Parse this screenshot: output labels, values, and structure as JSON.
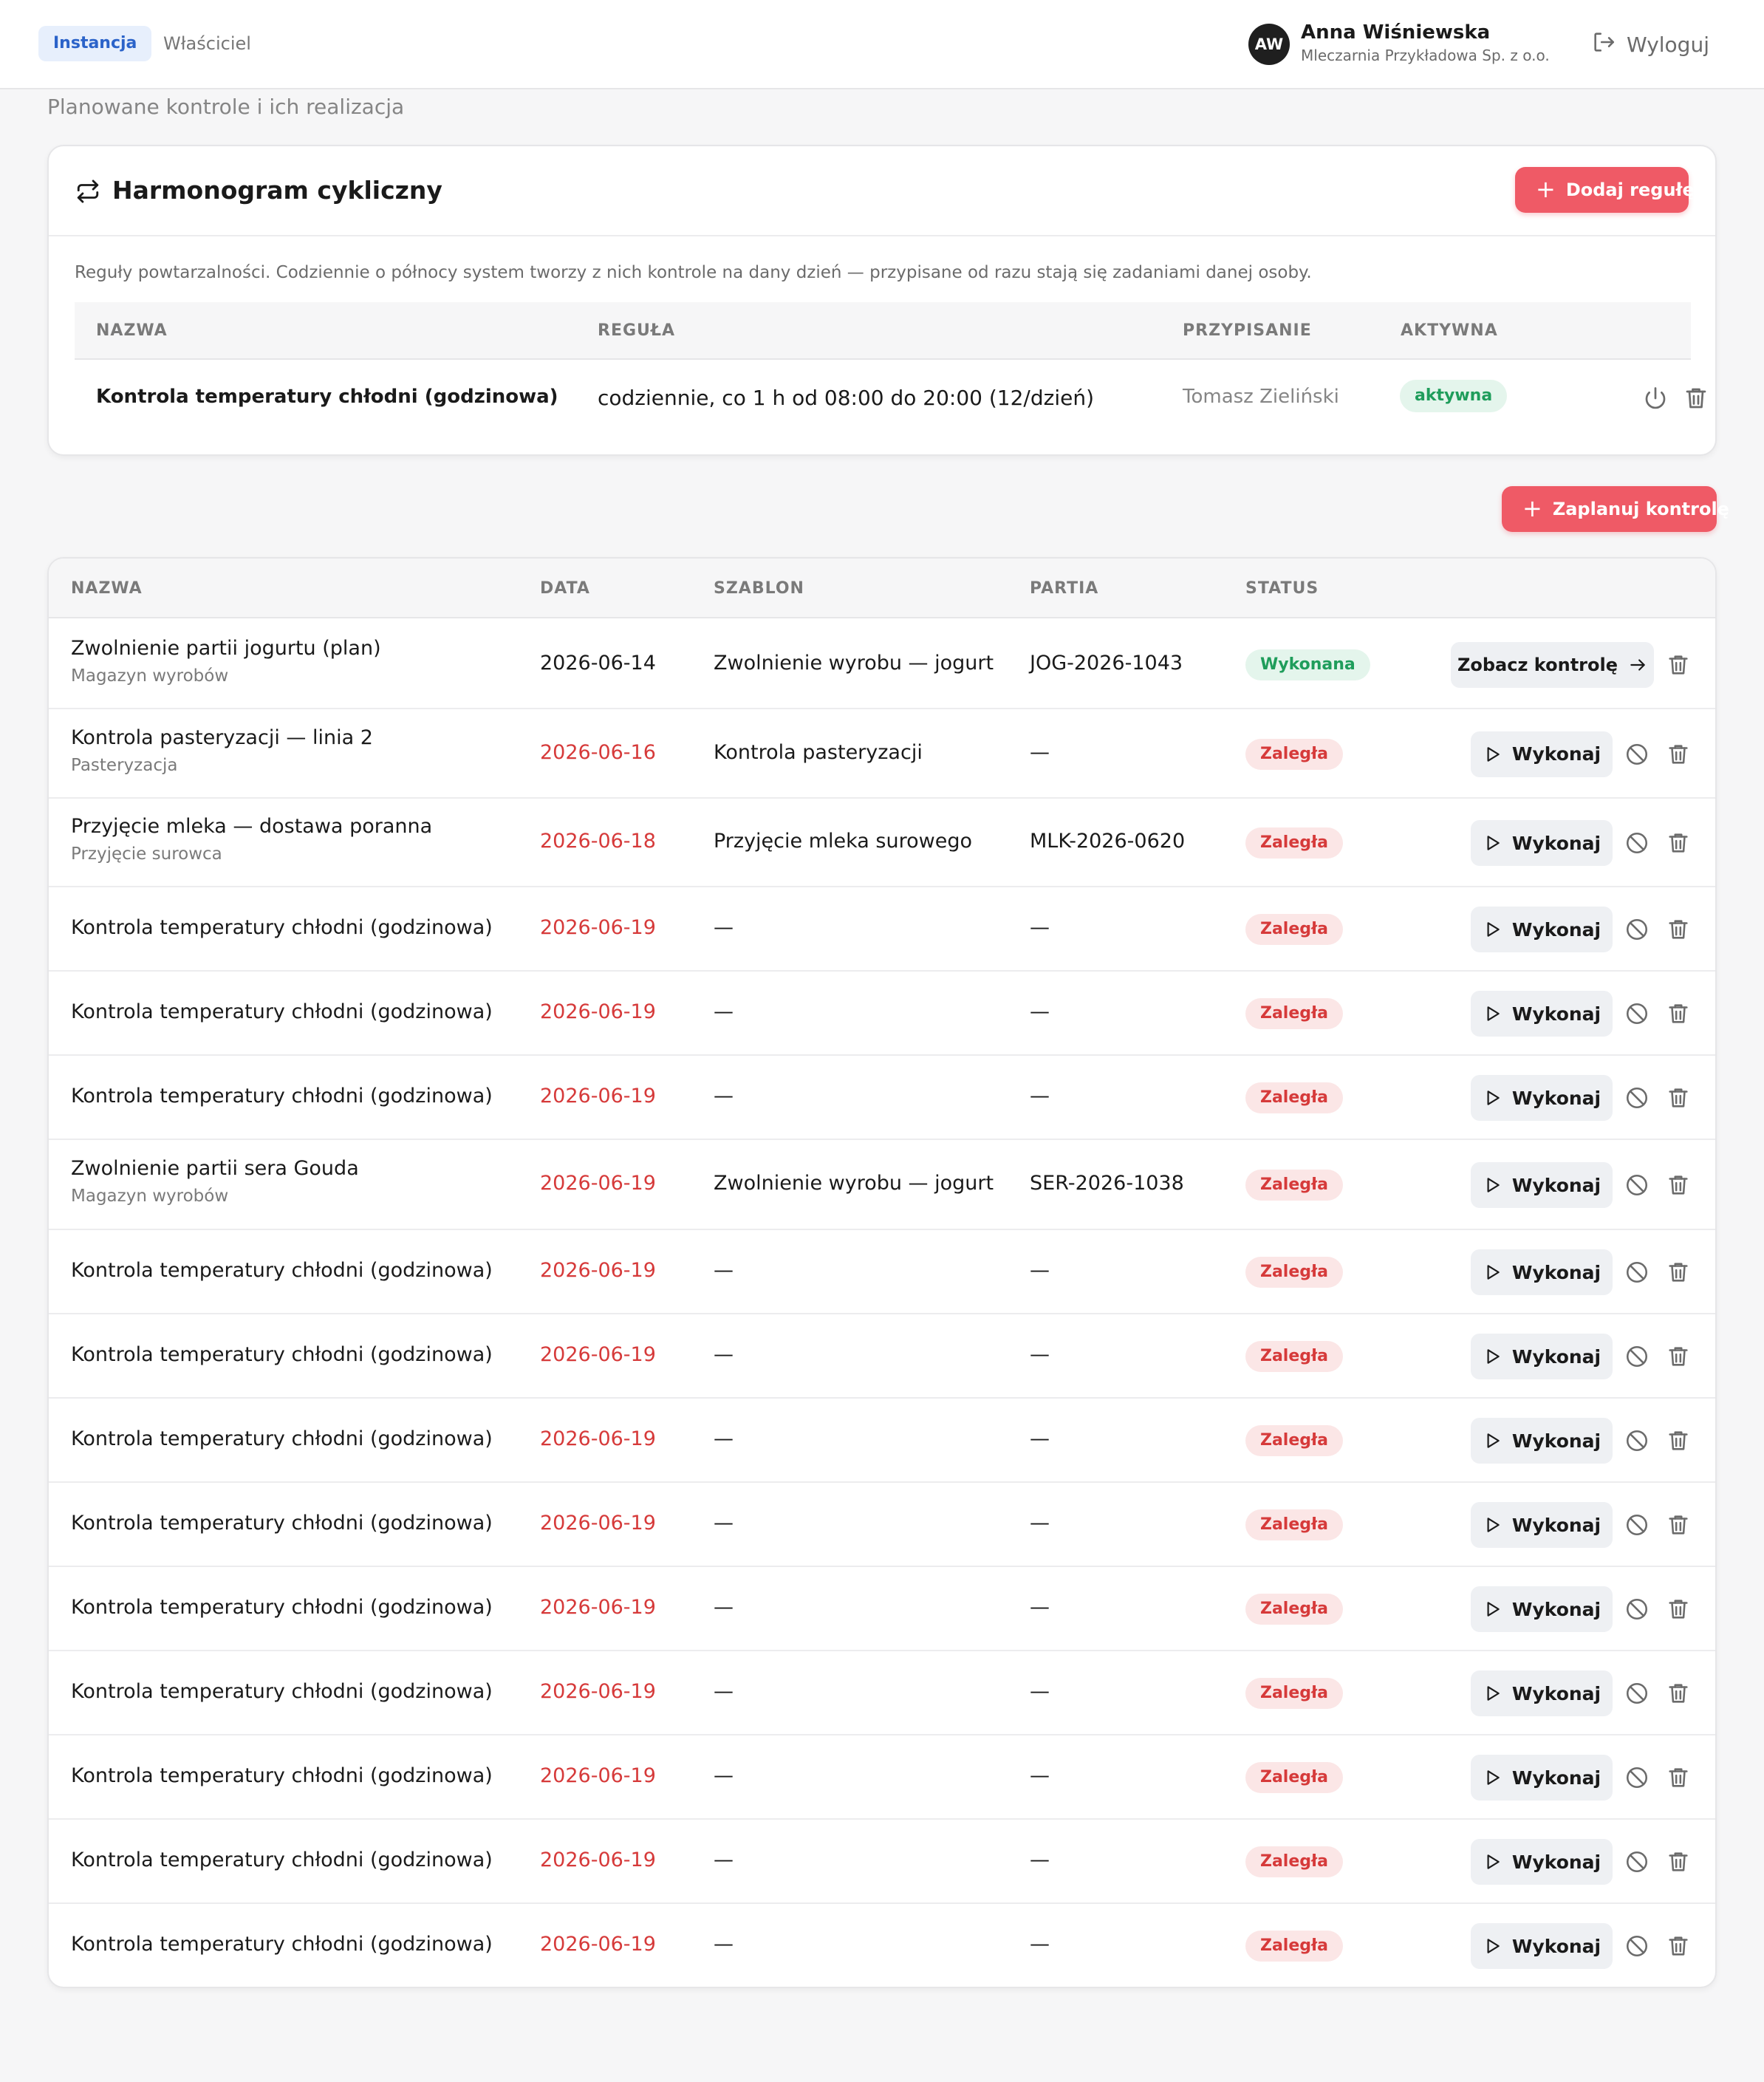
{
  "topbar": {
    "tabs": [
      {
        "label": "Instancja",
        "active": true
      },
      {
        "label": "Właściciel",
        "active": false
      }
    ],
    "user": {
      "initials": "AW",
      "name": "Anna Wiśniewska",
      "org": "Mleczarnia Przykładowa Sp. z o.o."
    },
    "logout_label": "Wyloguj"
  },
  "page": {
    "subtitle": "Planowane kontrole i ich realizacja"
  },
  "rules": {
    "title": "Harmonogram cykliczny",
    "add_button": "Dodaj regułę",
    "description": "Reguły powtarzalności. Codziennie o północy system tworzy z nich kontrole na dany dzień — przypisane od razu stają się zadaniami danej osoby.",
    "columns": [
      "NAZWA",
      "REGUŁA",
      "PRZYPISANIE",
      "AKTYWNA"
    ],
    "rows": [
      {
        "name": "Kontrola temperatury chłodni (godzinowa)",
        "rule": "codziennie, co 1 h od 08:00 do 20:00 (12/dzień)",
        "assignee": "Tomasz Zieliński",
        "active": "aktywna"
      }
    ]
  },
  "controls": {
    "plan_button": "Zaplanuj kontrolę",
    "columns": [
      "NAZWA",
      "DATA",
      "SZABLON",
      "PARTIA",
      "STATUS"
    ],
    "run_label": "Wykonaj",
    "view_label": "Zobacz kontrolę",
    "colors": {
      "overdue": "#d63a3a",
      "done": "#1f9d5b",
      "primary": "#ef5a66"
    },
    "rows": [
      {
        "name": "Zwolnienie partii jogurtu (plan)",
        "sub": "Magazyn wyrobów",
        "date": "2026-06-14",
        "template": "Zwolnienie wyrobu — jogurt",
        "batch": "JOG-2026-1043",
        "status": "Wykonana",
        "state": "done"
      },
      {
        "name": "Kontrola pasteryzacji — linia 2",
        "sub": "Pasteryzacja",
        "date": "2026-06-16",
        "template": "Kontrola pasteryzacji",
        "batch": "—",
        "status": "Zaległa",
        "state": "overdue"
      },
      {
        "name": "Przyjęcie mleka — dostawa poranna",
        "sub": "Przyjęcie surowca",
        "date": "2026-06-18",
        "template": "Przyjęcie mleka surowego",
        "batch": "MLK-2026-0620",
        "status": "Zaległa",
        "state": "overdue"
      },
      {
        "name": "Kontrola temperatury chłodni (godzinowa)",
        "sub": "",
        "date": "2026-06-19",
        "template": "—",
        "batch": "—",
        "status": "Zaległa",
        "state": "overdue"
      },
      {
        "name": "Kontrola temperatury chłodni (godzinowa)",
        "sub": "",
        "date": "2026-06-19",
        "template": "—",
        "batch": "—",
        "status": "Zaległa",
        "state": "overdue"
      },
      {
        "name": "Kontrola temperatury chłodni (godzinowa)",
        "sub": "",
        "date": "2026-06-19",
        "template": "—",
        "batch": "—",
        "status": "Zaległa",
        "state": "overdue"
      },
      {
        "name": "Zwolnienie partii sera Gouda",
        "sub": "Magazyn wyrobów",
        "date": "2026-06-19",
        "template": "Zwolnienie wyrobu — jogurt",
        "batch": "SER-2026-1038",
        "status": "Zaległa",
        "state": "overdue"
      },
      {
        "name": "Kontrola temperatury chłodni (godzinowa)",
        "sub": "",
        "date": "2026-06-19",
        "template": "—",
        "batch": "—",
        "status": "Zaległa",
        "state": "overdue"
      },
      {
        "name": "Kontrola temperatury chłodni (godzinowa)",
        "sub": "",
        "date": "2026-06-19",
        "template": "—",
        "batch": "—",
        "status": "Zaległa",
        "state": "overdue"
      },
      {
        "name": "Kontrola temperatury chłodni (godzinowa)",
        "sub": "",
        "date": "2026-06-19",
        "template": "—",
        "batch": "—",
        "status": "Zaległa",
        "state": "overdue"
      },
      {
        "name": "Kontrola temperatury chłodni (godzinowa)",
        "sub": "",
        "date": "2026-06-19",
        "template": "—",
        "batch": "—",
        "status": "Zaległa",
        "state": "overdue"
      },
      {
        "name": "Kontrola temperatury chłodni (godzinowa)",
        "sub": "",
        "date": "2026-06-19",
        "template": "—",
        "batch": "—",
        "status": "Zaległa",
        "state": "overdue"
      },
      {
        "name": "Kontrola temperatury chłodni (godzinowa)",
        "sub": "",
        "date": "2026-06-19",
        "template": "—",
        "batch": "—",
        "status": "Zaległa",
        "state": "overdue"
      },
      {
        "name": "Kontrola temperatury chłodni (godzinowa)",
        "sub": "",
        "date": "2026-06-19",
        "template": "—",
        "batch": "—",
        "status": "Zaległa",
        "state": "overdue"
      },
      {
        "name": "Kontrola temperatury chłodni (godzinowa)",
        "sub": "",
        "date": "2026-06-19",
        "template": "—",
        "batch": "—",
        "status": "Zaległa",
        "state": "overdue"
      },
      {
        "name": "Kontrola temperatury chłodni (godzinowa)",
        "sub": "",
        "date": "2026-06-19",
        "template": "—",
        "batch": "—",
        "status": "Zaległa",
        "state": "overdue"
      }
    ]
  }
}
